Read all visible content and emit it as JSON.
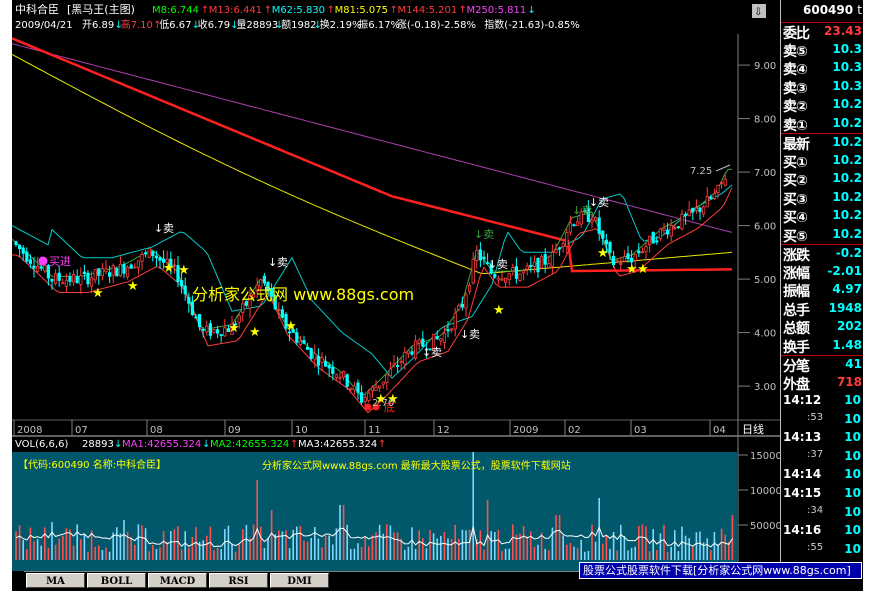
{
  "header": {
    "stock_name": "中科合臣",
    "tab_title": "[黑马王(主图)",
    "ma": [
      {
        "label": "M8:6.744",
        "color": "#00ff00",
        "arrow": "↑"
      },
      {
        "label": "M13:6.441",
        "color": "#ff3c3c",
        "arrow": "↑"
      },
      {
        "label": "M62:5.830",
        "color": "#00ffff",
        "arrow": "↑"
      },
      {
        "label": "M81:5.075",
        "color": "#ffff00",
        "arrow": "↑"
      },
      {
        "label": "M144:5.201",
        "color": "#ff3c3c",
        "arrow": "↑"
      },
      {
        "label": "M250:5.811",
        "color": "#ff40ff",
        "arrow": "↓"
      }
    ],
    "info_date": "2009/04/21",
    "info_items": [
      {
        "label": "开6.89",
        "color": "#ffffff"
      },
      {
        "label": "↓",
        "color": "#00ffff"
      },
      {
        "label": "高7.10",
        "color": "#ff3c3c"
      },
      {
        "label": "↑",
        "color": "#ff3c3c"
      },
      {
        "label": "低6.67",
        "color": "#ffffff"
      },
      {
        "label": "↓",
        "color": "#00ffff"
      },
      {
        "label": "收6.79",
        "color": "#ffffff"
      },
      {
        "label": "↓",
        "color": "#00ffff"
      },
      {
        "label": "量28893",
        "color": "#ffffff"
      },
      {
        "label": "↓",
        "color": "#00ffff"
      },
      {
        "label": "额1982",
        "color": "#ffffff"
      },
      {
        "label": "↓",
        "color": "#00ffff"
      },
      {
        "label": "换2.19%",
        "color": "#ffffff"
      },
      {
        "label": "振6.17%",
        "color": "#ffffff"
      },
      {
        "label": "涨(-0.18)-2.58%",
        "color": "#ffffff"
      },
      {
        "label": "指数(-21.63)-0.85%",
        "color": "#ffffff"
      }
    ]
  },
  "price_axis": [
    "9.00",
    "8.00",
    "7.00",
    "6.00",
    "5.00",
    "4.00",
    "3.00"
  ],
  "price_peak_label": "7.25",
  "price_low_label": "2.70",
  "date_axis": [
    "2008",
    "07",
    "08",
    "09",
    "10",
    "11",
    "12",
    "2009",
    "02",
    "03",
    "04"
  ],
  "period_label": "日线",
  "signals": {
    "buy": "买进",
    "sell": "卖",
    "bottom": "底",
    "star": "★"
  },
  "watermark": "分析家公式网 www.88gs.com",
  "volume_header": {
    "name": "VOL(6,6,6)",
    "items": [
      {
        "label": "28893",
        "color": "#ffffff"
      },
      {
        "label": "↓",
        "color": "#00ffff"
      },
      {
        "label": "MA1:42655.324",
        "color": "#ff40ff"
      },
      {
        "label": "↓",
        "color": "#00ffff"
      },
      {
        "label": "MA2:42655.324",
        "color": "#00ff00"
      },
      {
        "label": "↑",
        "color": "#ff3c3c"
      },
      {
        "label": "MA3:42655.324",
        "color": "#ffffff"
      },
      {
        "label": "↑",
        "color": "#ff3c3c"
      }
    ]
  },
  "volume_axis": [
    "150000",
    "100000",
    "50000"
  ],
  "info_band": {
    "code_text": "【代码:600490 名称:中科合臣】",
    "promo_text": "分析家公式网www.88gs.com 最新最大股票公式，股票软件下载网站"
  },
  "side_panel": {
    "code": "600490",
    "flag": "t",
    "quote": [
      {
        "label": "委比",
        "value": "23.43",
        "val_color": "red"
      },
      {
        "label": "卖⑤",
        "value": "10.3",
        "val_color": "cyan"
      },
      {
        "label": "卖④",
        "value": "10.3",
        "val_color": "cyan"
      },
      {
        "label": "卖③",
        "value": "10.3",
        "val_color": "cyan"
      },
      {
        "label": "卖②",
        "value": "10.2",
        "val_color": "cyan"
      },
      {
        "label": "卖①",
        "value": "10.2",
        "val_color": "cyan"
      },
      {
        "label": "最新",
        "value": "10.2",
        "val_color": "cyan"
      },
      {
        "label": "买①",
        "value": "10.2",
        "val_color": "cyan"
      },
      {
        "label": "买②",
        "value": "10.2",
        "val_color": "cyan"
      },
      {
        "label": "买③",
        "value": "10.2",
        "val_color": "cyan"
      },
      {
        "label": "买④",
        "value": "10.2",
        "val_color": "cyan"
      },
      {
        "label": "买⑤",
        "value": "10.2",
        "val_color": "cyan"
      },
      {
        "label": "涨跌",
        "value": "-0.2",
        "val_color": "cyan"
      },
      {
        "label": "涨幅",
        "value": "-2.01",
        "val_color": "cyan"
      },
      {
        "label": "振幅",
        "value": "4.97",
        "val_color": "cyan"
      },
      {
        "label": "总手",
        "value": "1948",
        "val_color": "cyan"
      },
      {
        "label": "总额",
        "value": "202",
        "val_color": "cyan"
      },
      {
        "label": "换手",
        "value": "1.48",
        "val_color": "cyan"
      },
      {
        "label": "分笔",
        "value": "41",
        "val_color": "cyan"
      },
      {
        "label": "外盘",
        "value": "718",
        "val_color": "red"
      }
    ],
    "ticks": [
      {
        "time": "14:12",
        "value": "10",
        "sub": false
      },
      {
        "time": ":53",
        "value": "10",
        "sub": true
      },
      {
        "time": "14:13",
        "value": "10",
        "sub": false
      },
      {
        "time": ":37",
        "value": "10",
        "sub": true
      },
      {
        "time": "14:14",
        "value": "10",
        "sub": false
      },
      {
        "time": "14:15",
        "value": "10",
        "sub": false
      },
      {
        "time": ":34",
        "value": "10",
        "sub": true
      },
      {
        "time": "14:16",
        "value": "10",
        "sub": false
      },
      {
        "time": ":55",
        "value": "10",
        "sub": true
      }
    ]
  },
  "indicator_tabs": [
    "MA",
    "BOLL",
    "MACD",
    "RSI",
    "DMI"
  ],
  "ad_bar": "股票公式股票软件下载[分析家公式网www.88gs.com]",
  "colors": {
    "background": "#000000",
    "up": "#ff3c3c",
    "down": "#00ffff",
    "yellow": "#ffff00",
    "magenta": "#ff40ff",
    "green": "#00ff00",
    "info_band": "#00586a"
  }
}
